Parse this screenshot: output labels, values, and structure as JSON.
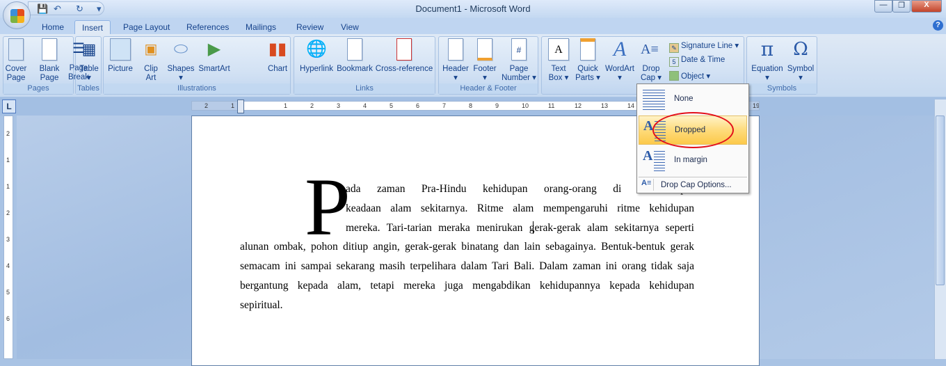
{
  "window": {
    "title": "Document1 - Microsoft Word",
    "minimize": "—",
    "restore": "❐",
    "close": "X",
    "help": "?"
  },
  "qat": {
    "save": "💾",
    "undo": "↶",
    "redo": "↻",
    "more": "▾"
  },
  "tabs": [
    "Home",
    "Insert",
    "Page Layout",
    "References",
    "Mailings",
    "Review",
    "View"
  ],
  "active_tab": "Insert",
  "ribbon": {
    "pages": {
      "label": "Pages",
      "buttons": [
        {
          "l1": "Cover",
          "l2": "Page ▾"
        },
        {
          "l1": "Blank",
          "l2": "Page"
        },
        {
          "l1": "Page",
          "l2": "Break"
        }
      ]
    },
    "tables": {
      "label": "Tables",
      "buttons": [
        {
          "l1": "Table",
          "l2": "▾"
        }
      ]
    },
    "illustrations": {
      "label": "Illustrations",
      "buttons": [
        {
          "l1": "Picture",
          "l2": ""
        },
        {
          "l1": "Clip",
          "l2": "Art"
        },
        {
          "l1": "Shapes",
          "l2": "▾"
        },
        {
          "l1": "SmartArt",
          "l2": ""
        },
        {
          "l1": "Chart",
          "l2": ""
        }
      ]
    },
    "links": {
      "label": "Links",
      "buttons": [
        {
          "l1": "Hyperlink",
          "l2": ""
        },
        {
          "l1": "Bookmark",
          "l2": ""
        },
        {
          "l1": "Cross-reference",
          "l2": ""
        }
      ]
    },
    "header_footer": {
      "label": "Header & Footer",
      "buttons": [
        {
          "l1": "Header",
          "l2": "▾"
        },
        {
          "l1": "Footer",
          "l2": "▾"
        },
        {
          "l1": "Page",
          "l2": "Number ▾"
        }
      ]
    },
    "text": {
      "label": "Text",
      "buttons": [
        {
          "l1": "Text",
          "l2": "Box ▾"
        },
        {
          "l1": "Quick",
          "l2": "Parts ▾"
        },
        {
          "l1": "WordArt",
          "l2": "▾"
        },
        {
          "l1": "Drop",
          "l2": "Cap ▾"
        }
      ],
      "small": [
        "Signature Line ▾",
        "Date & Time",
        "Object ▾"
      ]
    },
    "symbols": {
      "label": "Symbols",
      "buttons": [
        {
          "l1": "Equation",
          "l2": "▾"
        },
        {
          "l1": "Symbol",
          "l2": "▾"
        }
      ]
    }
  },
  "ruler": {
    "tab_selector": "L",
    "h_ticks": [
      "2",
      "1",
      "1",
      "2",
      "3",
      "4",
      "5",
      "6",
      "7",
      "8",
      "9",
      "10",
      "11",
      "12",
      "13",
      "14",
      "19"
    ],
    "v_ticks": [
      "2",
      "1",
      "1",
      "2",
      "3",
      "4",
      "5",
      "6"
    ]
  },
  "dropcap_menu": {
    "items": [
      "None",
      "Dropped",
      "In margin"
    ],
    "selected": "Dropped",
    "options": "Drop Cap Options..."
  },
  "document": {
    "drop_cap": "P",
    "lines": [
      "ada zaman Pra-Hindu kehidupan orang-orang di Bali diper",
      "keadaan alam sekitarnya. Ritme alam mempengaruhi ritme kehidupan",
      "mereka. Tari-tarian meraka menirukan gerak-gerak alam sekitarnya seperti",
      "alunan ombak, pohon ditiup angin, gerak-gerak binatang dan lain sebagainya. Bentuk-bentuk gerak",
      "semacam ini sampai sekarang masih terpelihara dalam Tari Bali. Dalam zaman ini orang tidak saja",
      "bergantung kepada alam, tetapi mereka juga mengabdikan kehidupannya kepada kehidupan",
      "sepiritual."
    ]
  }
}
